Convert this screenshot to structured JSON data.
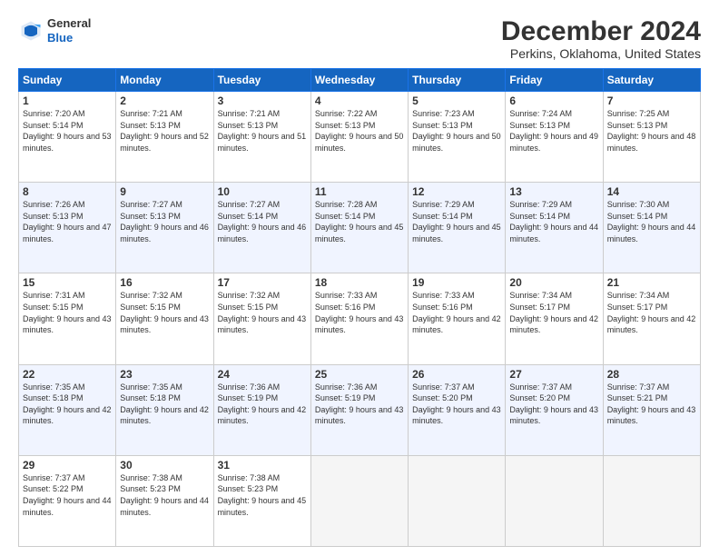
{
  "header": {
    "logo_general": "General",
    "logo_blue": "Blue",
    "month_title": "December 2024",
    "location": "Perkins, Oklahoma, United States"
  },
  "weekdays": [
    "Sunday",
    "Monday",
    "Tuesday",
    "Wednesday",
    "Thursday",
    "Friday",
    "Saturday"
  ],
  "weeks": [
    [
      {
        "day": "1",
        "sunrise": "Sunrise: 7:20 AM",
        "sunset": "Sunset: 5:14 PM",
        "daylight": "Daylight: 9 hours and 53 minutes."
      },
      {
        "day": "2",
        "sunrise": "Sunrise: 7:21 AM",
        "sunset": "Sunset: 5:13 PM",
        "daylight": "Daylight: 9 hours and 52 minutes."
      },
      {
        "day": "3",
        "sunrise": "Sunrise: 7:21 AM",
        "sunset": "Sunset: 5:13 PM",
        "daylight": "Daylight: 9 hours and 51 minutes."
      },
      {
        "day": "4",
        "sunrise": "Sunrise: 7:22 AM",
        "sunset": "Sunset: 5:13 PM",
        "daylight": "Daylight: 9 hours and 50 minutes."
      },
      {
        "day": "5",
        "sunrise": "Sunrise: 7:23 AM",
        "sunset": "Sunset: 5:13 PM",
        "daylight": "Daylight: 9 hours and 50 minutes."
      },
      {
        "day": "6",
        "sunrise": "Sunrise: 7:24 AM",
        "sunset": "Sunset: 5:13 PM",
        "daylight": "Daylight: 9 hours and 49 minutes."
      },
      {
        "day": "7",
        "sunrise": "Sunrise: 7:25 AM",
        "sunset": "Sunset: 5:13 PM",
        "daylight": "Daylight: 9 hours and 48 minutes."
      }
    ],
    [
      {
        "day": "8",
        "sunrise": "Sunrise: 7:26 AM",
        "sunset": "Sunset: 5:13 PM",
        "daylight": "Daylight: 9 hours and 47 minutes."
      },
      {
        "day": "9",
        "sunrise": "Sunrise: 7:27 AM",
        "sunset": "Sunset: 5:13 PM",
        "daylight": "Daylight: 9 hours and 46 minutes."
      },
      {
        "day": "10",
        "sunrise": "Sunrise: 7:27 AM",
        "sunset": "Sunset: 5:14 PM",
        "daylight": "Daylight: 9 hours and 46 minutes."
      },
      {
        "day": "11",
        "sunrise": "Sunrise: 7:28 AM",
        "sunset": "Sunset: 5:14 PM",
        "daylight": "Daylight: 9 hours and 45 minutes."
      },
      {
        "day": "12",
        "sunrise": "Sunrise: 7:29 AM",
        "sunset": "Sunset: 5:14 PM",
        "daylight": "Daylight: 9 hours and 45 minutes."
      },
      {
        "day": "13",
        "sunrise": "Sunrise: 7:29 AM",
        "sunset": "Sunset: 5:14 PM",
        "daylight": "Daylight: 9 hours and 44 minutes."
      },
      {
        "day": "14",
        "sunrise": "Sunrise: 7:30 AM",
        "sunset": "Sunset: 5:14 PM",
        "daylight": "Daylight: 9 hours and 44 minutes."
      }
    ],
    [
      {
        "day": "15",
        "sunrise": "Sunrise: 7:31 AM",
        "sunset": "Sunset: 5:15 PM",
        "daylight": "Daylight: 9 hours and 43 minutes."
      },
      {
        "day": "16",
        "sunrise": "Sunrise: 7:32 AM",
        "sunset": "Sunset: 5:15 PM",
        "daylight": "Daylight: 9 hours and 43 minutes."
      },
      {
        "day": "17",
        "sunrise": "Sunrise: 7:32 AM",
        "sunset": "Sunset: 5:15 PM",
        "daylight": "Daylight: 9 hours and 43 minutes."
      },
      {
        "day": "18",
        "sunrise": "Sunrise: 7:33 AM",
        "sunset": "Sunset: 5:16 PM",
        "daylight": "Daylight: 9 hours and 43 minutes."
      },
      {
        "day": "19",
        "sunrise": "Sunrise: 7:33 AM",
        "sunset": "Sunset: 5:16 PM",
        "daylight": "Daylight: 9 hours and 42 minutes."
      },
      {
        "day": "20",
        "sunrise": "Sunrise: 7:34 AM",
        "sunset": "Sunset: 5:17 PM",
        "daylight": "Daylight: 9 hours and 42 minutes."
      },
      {
        "day": "21",
        "sunrise": "Sunrise: 7:34 AM",
        "sunset": "Sunset: 5:17 PM",
        "daylight": "Daylight: 9 hours and 42 minutes."
      }
    ],
    [
      {
        "day": "22",
        "sunrise": "Sunrise: 7:35 AM",
        "sunset": "Sunset: 5:18 PM",
        "daylight": "Daylight: 9 hours and 42 minutes."
      },
      {
        "day": "23",
        "sunrise": "Sunrise: 7:35 AM",
        "sunset": "Sunset: 5:18 PM",
        "daylight": "Daylight: 9 hours and 42 minutes."
      },
      {
        "day": "24",
        "sunrise": "Sunrise: 7:36 AM",
        "sunset": "Sunset: 5:19 PM",
        "daylight": "Daylight: 9 hours and 42 minutes."
      },
      {
        "day": "25",
        "sunrise": "Sunrise: 7:36 AM",
        "sunset": "Sunset: 5:19 PM",
        "daylight": "Daylight: 9 hours and 43 minutes."
      },
      {
        "day": "26",
        "sunrise": "Sunrise: 7:37 AM",
        "sunset": "Sunset: 5:20 PM",
        "daylight": "Daylight: 9 hours and 43 minutes."
      },
      {
        "day": "27",
        "sunrise": "Sunrise: 7:37 AM",
        "sunset": "Sunset: 5:20 PM",
        "daylight": "Daylight: 9 hours and 43 minutes."
      },
      {
        "day": "28",
        "sunrise": "Sunrise: 7:37 AM",
        "sunset": "Sunset: 5:21 PM",
        "daylight": "Daylight: 9 hours and 43 minutes."
      }
    ],
    [
      {
        "day": "29",
        "sunrise": "Sunrise: 7:37 AM",
        "sunset": "Sunset: 5:22 PM",
        "daylight": "Daylight: 9 hours and 44 minutes."
      },
      {
        "day": "30",
        "sunrise": "Sunrise: 7:38 AM",
        "sunset": "Sunset: 5:23 PM",
        "daylight": "Daylight: 9 hours and 44 minutes."
      },
      {
        "day": "31",
        "sunrise": "Sunrise: 7:38 AM",
        "sunset": "Sunset: 5:23 PM",
        "daylight": "Daylight: 9 hours and 45 minutes."
      },
      null,
      null,
      null,
      null
    ]
  ]
}
